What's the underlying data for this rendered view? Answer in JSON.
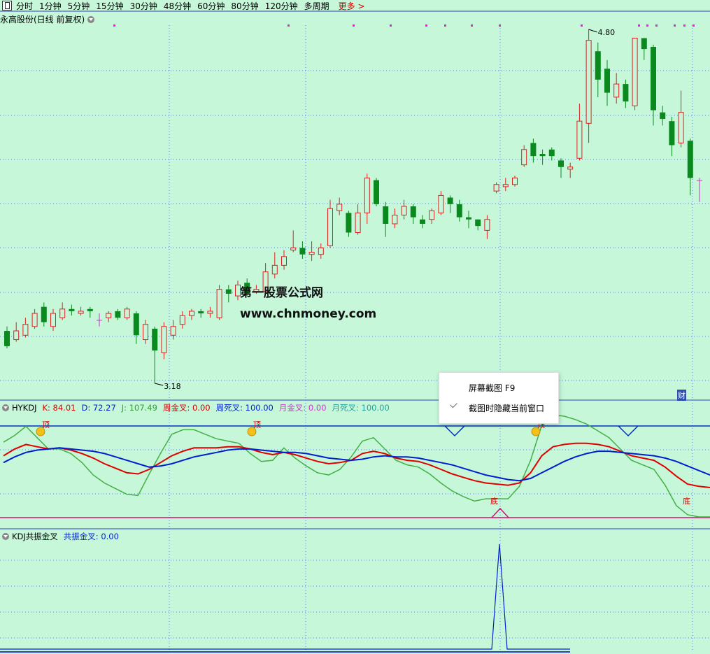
{
  "toolbar": {
    "periods": [
      "分时",
      "1分钟",
      "5分钟",
      "15分钟",
      "30分钟",
      "48分钟",
      "60分钟",
      "80分钟",
      "120分钟",
      "多周期"
    ],
    "more": "更多 >"
  },
  "stock": {
    "title": "永高股份(日线 前复权)"
  },
  "price_chart": {
    "high_label": "4.80",
    "low_label": "3.18",
    "up_color": "#e02020",
    "down_color": "#0a8a1e",
    "doji_color": "#cc33cc",
    "candles": [
      [
        3.42,
        3.35,
        3.44,
        3.34
      ],
      [
        3.38,
        3.42,
        3.46,
        3.37
      ],
      [
        3.4,
        3.45,
        3.48,
        3.39
      ],
      [
        3.44,
        3.5,
        3.52,
        3.43
      ],
      [
        3.53,
        3.46,
        3.55,
        3.44
      ],
      [
        3.44,
        3.5,
        3.52,
        3.42
      ],
      [
        3.48,
        3.52,
        3.55,
        3.47
      ],
      [
        3.52,
        3.51,
        3.54,
        3.49
      ],
      [
        3.5,
        3.51,
        3.53,
        3.49
      ],
      [
        3.52,
        3.51,
        3.53,
        3.48
      ],
      [
        3.47,
        3.47,
        3.5,
        3.44
      ],
      [
        3.48,
        3.5,
        3.51,
        3.46
      ],
      [
        3.51,
        3.48,
        3.52,
        3.47
      ],
      [
        3.48,
        3.52,
        3.53,
        3.47
      ],
      [
        3.5,
        3.4,
        3.51,
        3.36
      ],
      [
        3.38,
        3.45,
        3.47,
        3.36
      ],
      [
        3.43,
        3.33,
        3.44,
        3.18
      ],
      [
        3.32,
        3.44,
        3.46,
        3.29
      ],
      [
        3.4,
        3.44,
        3.47,
        3.38
      ],
      [
        3.45,
        3.49,
        3.51,
        3.43
      ],
      [
        3.49,
        3.51,
        3.52,
        3.47
      ],
      [
        3.51,
        3.5,
        3.52,
        3.48
      ],
      [
        3.5,
        3.51,
        3.53,
        3.48
      ],
      [
        3.48,
        3.61,
        3.63,
        3.47
      ],
      [
        3.61,
        3.59,
        3.63,
        3.55
      ],
      [
        3.58,
        3.63,
        3.65,
        3.56
      ],
      [
        3.64,
        3.59,
        3.66,
        3.58
      ],
      [
        3.6,
        3.61,
        3.63,
        3.59
      ],
      [
        3.6,
        3.69,
        3.73,
        3.59
      ],
      [
        3.68,
        3.72,
        3.78,
        3.66
      ],
      [
        3.72,
        3.76,
        3.79,
        3.7
      ],
      [
        3.79,
        3.8,
        3.88,
        3.78
      ],
      [
        3.8,
        3.77,
        3.83,
        3.75
      ],
      [
        3.77,
        3.78,
        3.83,
        3.74
      ],
      [
        3.77,
        3.8,
        3.82,
        3.75
      ],
      [
        3.81,
        3.98,
        4.02,
        3.8
      ],
      [
        3.97,
        4.0,
        4.03,
        3.95
      ],
      [
        3.96,
        3.87,
        3.97,
        3.85
      ],
      [
        3.87,
        3.96,
        4.0,
        3.86
      ],
      [
        3.96,
        4.12,
        4.14,
        3.91
      ],
      [
        4.11,
        4.0,
        4.12,
        3.99
      ],
      [
        3.99,
        3.91,
        4.01,
        3.85
      ],
      [
        3.91,
        3.95,
        3.98,
        3.89
      ],
      [
        3.95,
        3.99,
        4.02,
        3.93
      ],
      [
        3.99,
        3.94,
        4.0,
        3.91
      ],
      [
        3.93,
        3.91,
        3.95,
        3.89
      ],
      [
        3.93,
        3.97,
        3.98,
        3.91
      ],
      [
        3.96,
        4.04,
        4.06,
        3.95
      ],
      [
        4.03,
        4.0,
        4.04,
        3.96
      ],
      [
        4.0,
        3.94,
        4.02,
        3.92
      ],
      [
        3.94,
        3.93,
        3.97,
        3.89
      ],
      [
        3.93,
        3.9,
        3.93,
        3.88
      ],
      [
        3.88,
        3.93,
        3.95,
        3.84
      ],
      [
        4.06,
        4.09,
        4.1,
        4.05
      ],
      [
        4.08,
        4.09,
        4.12,
        4.06
      ],
      [
        4.09,
        4.12,
        4.13,
        4.08
      ],
      [
        4.18,
        4.25,
        4.27,
        4.17
      ],
      [
        4.28,
        4.22,
        4.3,
        4.19
      ],
      [
        4.23,
        4.22,
        4.25,
        4.18
      ],
      [
        4.25,
        4.22,
        4.26,
        4.2
      ],
      [
        4.2,
        4.17,
        4.21,
        4.12
      ],
      [
        4.16,
        4.17,
        4.19,
        4.12
      ],
      [
        4.21,
        4.38,
        4.46,
        4.2
      ],
      [
        4.37,
        4.75,
        4.8,
        4.28
      ],
      [
        4.7,
        4.57,
        4.74,
        4.49
      ],
      [
        4.62,
        4.51,
        4.66,
        4.45
      ],
      [
        4.49,
        4.55,
        4.6,
        4.46
      ],
      [
        4.55,
        4.47,
        4.57,
        4.44
      ],
      [
        4.45,
        4.76,
        4.76,
        4.43
      ],
      [
        4.76,
        4.71,
        4.76,
        4.66
      ],
      [
        4.72,
        4.43,
        4.73,
        4.36
      ],
      [
        4.42,
        4.39,
        4.45,
        4.36
      ],
      [
        4.38,
        4.27,
        4.4,
        4.22
      ],
      [
        4.28,
        4.42,
        4.52,
        4.26
      ],
      [
        4.29,
        4.12,
        4.3,
        4.04
      ],
      [
        4.11,
        4.11,
        4.12,
        4.01
      ]
    ]
  },
  "indicator1": {
    "name": "HYKDJ",
    "k": "K: 84.01",
    "d": "D: 72.27",
    "j": "J: 107.49",
    "week_golden": "周金叉: 0.00",
    "week_dead": "周死叉: 100.00",
    "month_golden": "月金叉: 0.00",
    "month_dead": "月死叉: 100.00",
    "top_label": "顶",
    "bottom_label": "底",
    "k_color": "#e00000",
    "d_color": "#0020d0",
    "j_color": "#44b044",
    "k_values": [
      62,
      68,
      72,
      70,
      68,
      69,
      67,
      64,
      60,
      55,
      51,
      47,
      46,
      50,
      56,
      62,
      66,
      69,
      69,
      69,
      70,
      70,
      68,
      65,
      63,
      65,
      63,
      60,
      57,
      55,
      56,
      58,
      64,
      66,
      64,
      60,
      58,
      57,
      54,
      50,
      46,
      43,
      40,
      38,
      37,
      36,
      38,
      47,
      62,
      70,
      72,
      73,
      73,
      72,
      70,
      66,
      62,
      60,
      58,
      52,
      44,
      37,
      35,
      34
    ],
    "d_values": [
      56,
      61,
      65,
      67,
      68,
      69,
      68,
      67,
      66,
      64,
      61,
      58,
      55,
      52,
      53,
      55,
      58,
      61,
      63,
      65,
      67,
      68,
      68,
      67,
      66,
      65,
      65,
      64,
      62,
      60,
      59,
      58,
      59,
      61,
      62,
      61,
      61,
      60,
      58,
      56,
      54,
      51,
      48,
      45,
      43,
      41,
      40,
      42,
      47,
      52,
      57,
      61,
      64,
      66,
      66,
      65,
      64,
      63,
      62,
      60,
      57,
      53,
      49,
      45
    ],
    "j_values": [
      74,
      80,
      88,
      78,
      68,
      68,
      64,
      56,
      45,
      38,
      33,
      28,
      27,
      46,
      64,
      81,
      85,
      85,
      81,
      77,
      75,
      73,
      64,
      57,
      58,
      69,
      60,
      53,
      47,
      45,
      50,
      61,
      75,
      78,
      68,
      58,
      54,
      52,
      46,
      38,
      31,
      26,
      22,
      24,
      24,
      24,
      35,
      58,
      89,
      98,
      97,
      94,
      90,
      84,
      78,
      68,
      58,
      54,
      50,
      36,
      18,
      10,
      8,
      8
    ]
  },
  "indicator2": {
    "name": "KDJ共振金叉",
    "value": "共振金叉: 0.00"
  },
  "context_menu": {
    "item1": "屏幕截图 F9",
    "item2": "截图时隐藏当前窗口"
  },
  "watermark": {
    "line1": "第一股票公式网",
    "line2": "www.chnmoney.com"
  },
  "corner_tag": "财"
}
